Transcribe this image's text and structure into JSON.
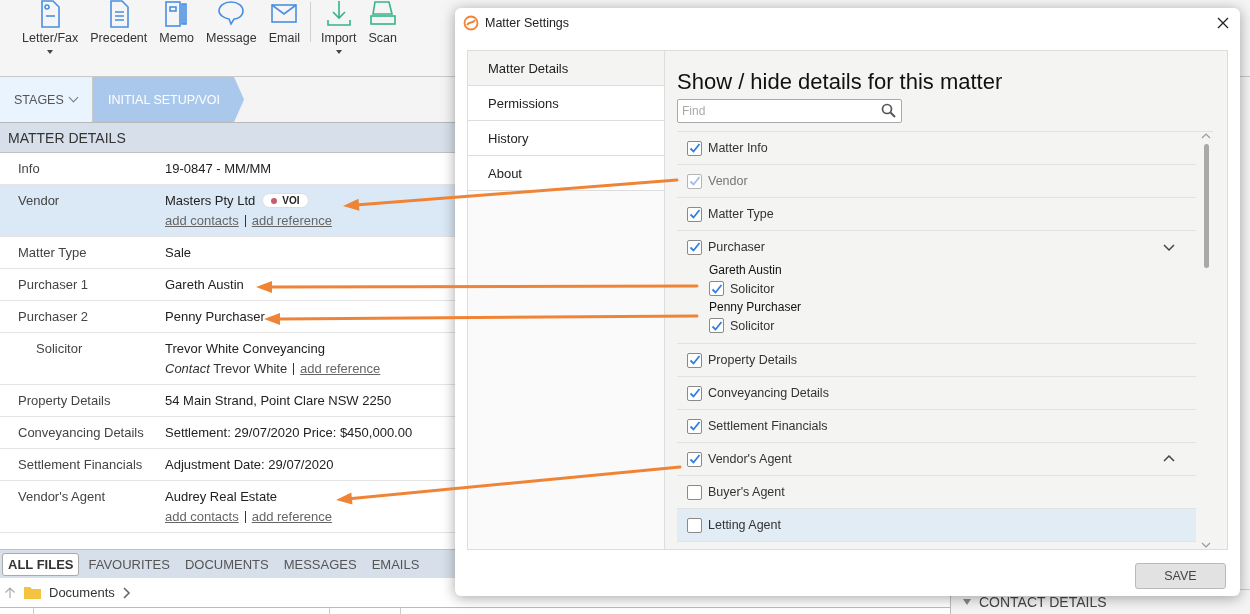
{
  "toolbar": {
    "items": [
      {
        "label": "Letter/Fax",
        "dropdown": true
      },
      {
        "label": "Precedent",
        "dropdown": false
      },
      {
        "label": "Memo",
        "dropdown": false
      },
      {
        "label": "Message",
        "dropdown": false
      },
      {
        "label": "Email",
        "dropdown": false
      },
      {
        "label": "Import",
        "dropdown": true
      },
      {
        "label": "Scan",
        "dropdown": false
      }
    ]
  },
  "stages": {
    "label": "STAGES",
    "current": "INITIAL SETUP/VOI"
  },
  "matter_details": {
    "title": "MATTER DETAILS",
    "rows": [
      {
        "label": "Info",
        "value": "19-0847 - MM/MM",
        "selected": false
      },
      {
        "label": "Vendor",
        "value": "Masters Pty Ltd",
        "badge": {
          "label": "VOI",
          "color": "#c95a6e"
        },
        "links": [
          "add contacts",
          "add reference"
        ],
        "selected": true
      },
      {
        "label": "Matter Type",
        "value": "Sale",
        "selected": false
      },
      {
        "label": "Purchaser 1",
        "value": "Gareth Austin",
        "selected": false
      },
      {
        "label": "Purchaser 2",
        "value": "Penny Purchaser",
        "selected": false,
        "children": [
          {
            "label": "Solicitor",
            "value": "Trevor White Conveyancing",
            "contact": "*Contact* Trevor White",
            "links": [
              "add reference"
            ],
            "selected": false
          }
        ]
      },
      {
        "label": "Property Details",
        "value": "54 Main Strand, Point Clare NSW 2250",
        "selected": false
      },
      {
        "label": "Conveyancing Details",
        "value": "Settlement: 29/07/2020 Price: $450,000.00",
        "selected": false
      },
      {
        "label": "Settlement Financials",
        "value": "Adjustment Date: 29/07/2020",
        "selected": false
      },
      {
        "label": "Vendor's Agent",
        "value": "Audrey Real Estate",
        "links": [
          "add contacts",
          "add reference"
        ],
        "selected": false
      }
    ]
  },
  "file_tabs": [
    {
      "label": "ALL FILES",
      "selected": true
    },
    {
      "label": "FAVOURITES",
      "selected": false
    },
    {
      "label": "DOCUMENTS",
      "selected": false
    },
    {
      "label": "MESSAGES",
      "selected": false
    },
    {
      "label": "EMAILS",
      "selected": false
    }
  ],
  "breadcrumb": {
    "folder": "Documents"
  },
  "contact_details": {
    "title": "CONTACT DETAILS"
  },
  "dialog": {
    "title": "Matter Settings",
    "nav": [
      {
        "label": "Matter Details",
        "selected": true
      },
      {
        "label": "Permissions",
        "selected": false
      },
      {
        "label": "History",
        "selected": false
      },
      {
        "label": "About",
        "selected": false
      }
    ],
    "heading": "Show / hide details for this matter",
    "search": {
      "placeholder": "Find"
    },
    "items": [
      {
        "label": "Matter Info",
        "checked": true,
        "disabled": false,
        "selected": false
      },
      {
        "label": "Vendor",
        "checked": true,
        "disabled": true,
        "selected": false
      },
      {
        "label": "Matter Type",
        "checked": true,
        "disabled": false,
        "selected": false
      },
      {
        "label": "Purchaser",
        "checked": true,
        "disabled": false,
        "selected": false,
        "expanded": true,
        "children": [
          {
            "name": "Gareth Austin",
            "options": [
              {
                "label": "Solicitor",
                "checked": true
              }
            ]
          },
          {
            "name": "Penny Purchaser",
            "options": [
              {
                "label": "Solicitor",
                "checked": true
              }
            ]
          }
        ]
      },
      {
        "label": "Property Details",
        "checked": true,
        "disabled": false,
        "selected": false
      },
      {
        "label": "Conveyancing Details",
        "checked": true,
        "disabled": false,
        "selected": false
      },
      {
        "label": "Settlement Financials",
        "checked": true,
        "disabled": false,
        "selected": false
      },
      {
        "label": "Vendor's Agent",
        "checked": true,
        "disabled": false,
        "selected": false,
        "expanded": false
      },
      {
        "label": "Buyer's Agent",
        "checked": false,
        "disabled": false,
        "selected": false
      },
      {
        "label": "Letting Agent",
        "checked": false,
        "disabled": false,
        "selected": true
      }
    ],
    "save": "SAVE"
  }
}
